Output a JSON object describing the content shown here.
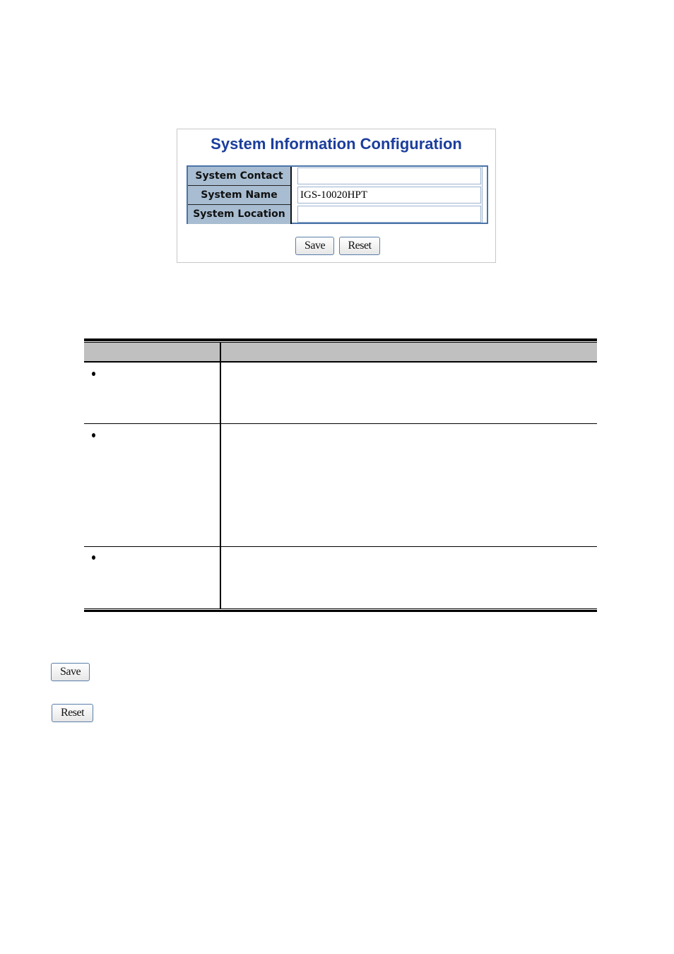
{
  "config_panel": {
    "title": "System Information Configuration",
    "fields": [
      {
        "label": "System Contact",
        "value": ""
      },
      {
        "label": "System Name",
        "value": "IGS-10020HPT"
      },
      {
        "label": "System Location",
        "value": ""
      }
    ],
    "save_label": "Save",
    "reset_label": "Reset"
  },
  "description_table": {
    "headers": [
      "",
      ""
    ],
    "rows": [
      {
        "object": "",
        "description": ""
      },
      {
        "object": "",
        "description": ""
      },
      {
        "object": "",
        "description": ""
      }
    ]
  },
  "buttons_legend": {
    "save_label": "Save",
    "reset_label": "Reset"
  },
  "colors": {
    "title_blue": "#1b3d9c",
    "label_bg": "#a8bdd2",
    "table_border": "#4a74a8",
    "header_gray": "#c0c0c0"
  }
}
